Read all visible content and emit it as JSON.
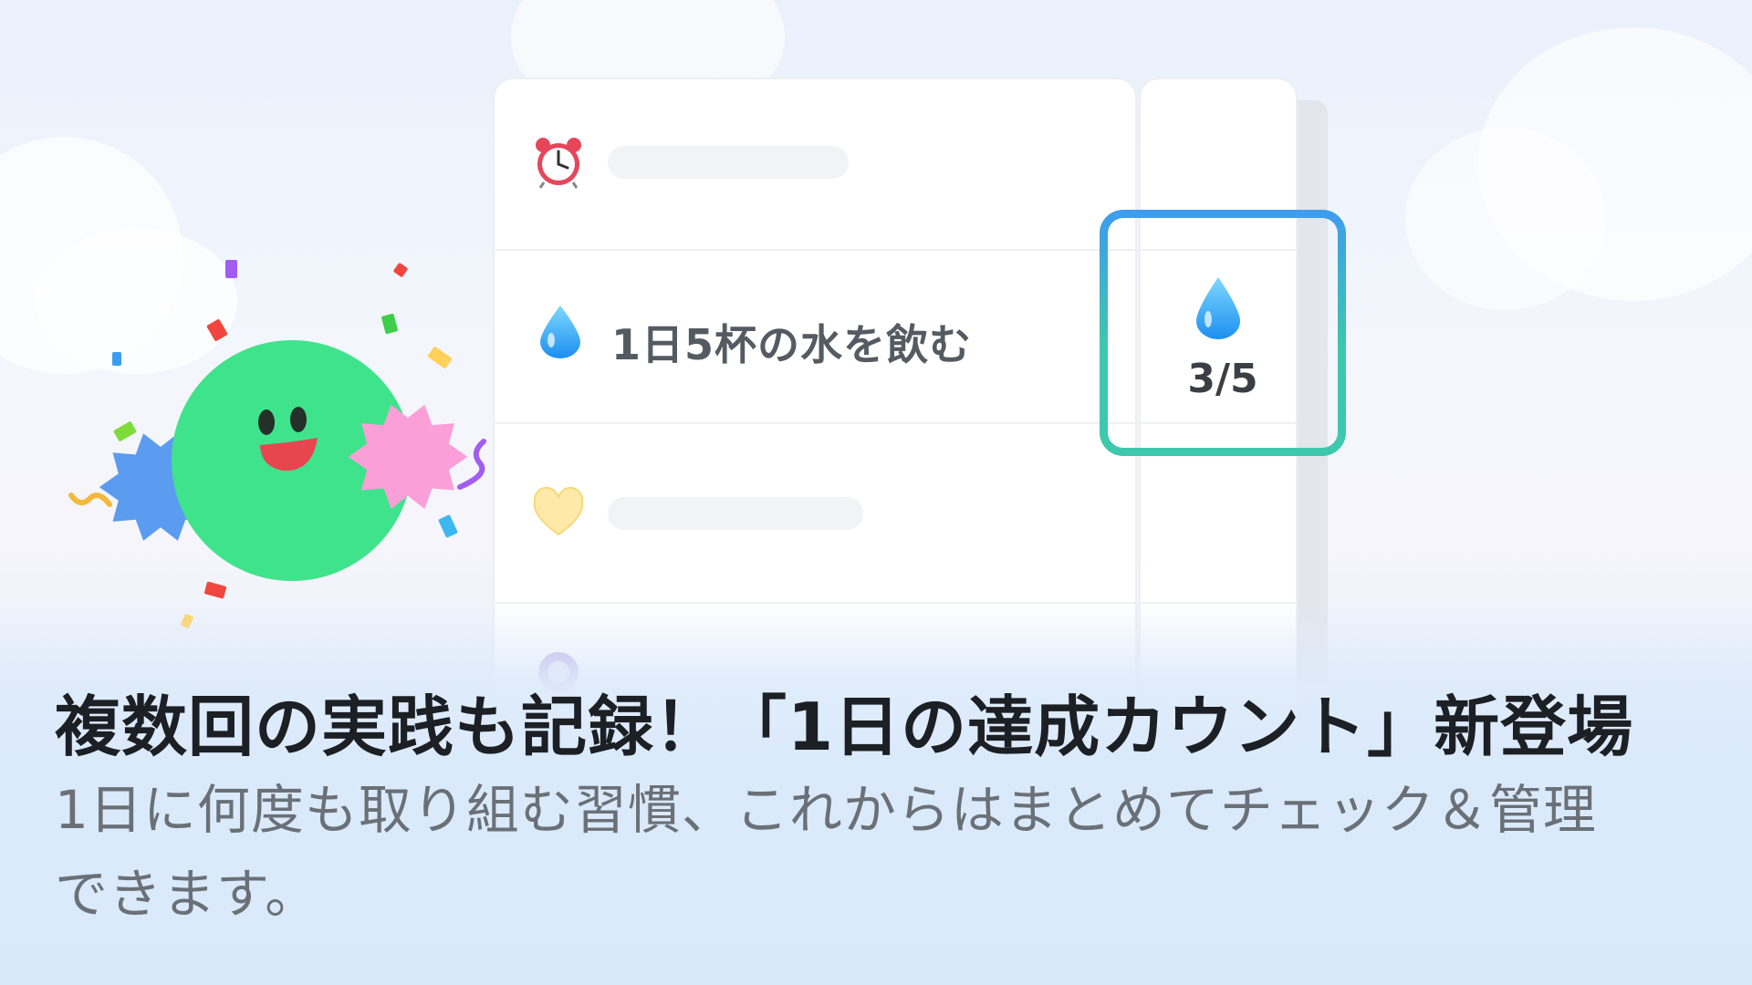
{
  "habits": [
    {
      "icon": "alarm-clock-icon",
      "label": ""
    },
    {
      "icon": "water-drop-icon",
      "label": "1日5杯の水を飲む"
    },
    {
      "icon": "yellow-heart-icon",
      "label": ""
    },
    {
      "icon": "purple-item-icon",
      "label": ""
    }
  ],
  "counter": {
    "icon": "water-drop-icon",
    "text": "3/5",
    "done": 3,
    "target": 5
  },
  "headline": "複数回の実践も記録！「1日の達成カウント」新登場",
  "subtext_line1": "1日に何度も取り組む習慣、これからはまとめてチェック＆管理",
  "subtext_line2": "できます。",
  "colors": {
    "mascot": "#3fe38b",
    "flower_blue": "#5b9bf0",
    "flower_pink": "#fb9fd8",
    "counter_border_top": "#3f9bef",
    "counter_border_bottom": "#3ec8ad"
  }
}
